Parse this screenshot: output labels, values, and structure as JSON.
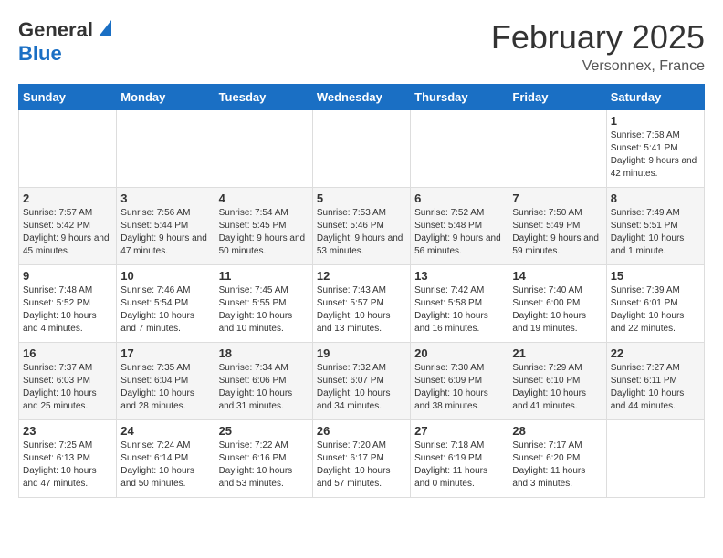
{
  "header": {
    "logo_general": "General",
    "logo_blue": "Blue",
    "month_title": "February 2025",
    "location": "Versonnex, France"
  },
  "calendar": {
    "days_of_week": [
      "Sunday",
      "Monday",
      "Tuesday",
      "Wednesday",
      "Thursday",
      "Friday",
      "Saturday"
    ],
    "weeks": [
      [
        {
          "day": "",
          "info": ""
        },
        {
          "day": "",
          "info": ""
        },
        {
          "day": "",
          "info": ""
        },
        {
          "day": "",
          "info": ""
        },
        {
          "day": "",
          "info": ""
        },
        {
          "day": "",
          "info": ""
        },
        {
          "day": "1",
          "info": "Sunrise: 7:58 AM\nSunset: 5:41 PM\nDaylight: 9 hours and 42 minutes."
        }
      ],
      [
        {
          "day": "2",
          "info": "Sunrise: 7:57 AM\nSunset: 5:42 PM\nDaylight: 9 hours and 45 minutes."
        },
        {
          "day": "3",
          "info": "Sunrise: 7:56 AM\nSunset: 5:44 PM\nDaylight: 9 hours and 47 minutes."
        },
        {
          "day": "4",
          "info": "Sunrise: 7:54 AM\nSunset: 5:45 PM\nDaylight: 9 hours and 50 minutes."
        },
        {
          "day": "5",
          "info": "Sunrise: 7:53 AM\nSunset: 5:46 PM\nDaylight: 9 hours and 53 minutes."
        },
        {
          "day": "6",
          "info": "Sunrise: 7:52 AM\nSunset: 5:48 PM\nDaylight: 9 hours and 56 minutes."
        },
        {
          "day": "7",
          "info": "Sunrise: 7:50 AM\nSunset: 5:49 PM\nDaylight: 9 hours and 59 minutes."
        },
        {
          "day": "8",
          "info": "Sunrise: 7:49 AM\nSunset: 5:51 PM\nDaylight: 10 hours and 1 minute."
        }
      ],
      [
        {
          "day": "9",
          "info": "Sunrise: 7:48 AM\nSunset: 5:52 PM\nDaylight: 10 hours and 4 minutes."
        },
        {
          "day": "10",
          "info": "Sunrise: 7:46 AM\nSunset: 5:54 PM\nDaylight: 10 hours and 7 minutes."
        },
        {
          "day": "11",
          "info": "Sunrise: 7:45 AM\nSunset: 5:55 PM\nDaylight: 10 hours and 10 minutes."
        },
        {
          "day": "12",
          "info": "Sunrise: 7:43 AM\nSunset: 5:57 PM\nDaylight: 10 hours and 13 minutes."
        },
        {
          "day": "13",
          "info": "Sunrise: 7:42 AM\nSunset: 5:58 PM\nDaylight: 10 hours and 16 minutes."
        },
        {
          "day": "14",
          "info": "Sunrise: 7:40 AM\nSunset: 6:00 PM\nDaylight: 10 hours and 19 minutes."
        },
        {
          "day": "15",
          "info": "Sunrise: 7:39 AM\nSunset: 6:01 PM\nDaylight: 10 hours and 22 minutes."
        }
      ],
      [
        {
          "day": "16",
          "info": "Sunrise: 7:37 AM\nSunset: 6:03 PM\nDaylight: 10 hours and 25 minutes."
        },
        {
          "day": "17",
          "info": "Sunrise: 7:35 AM\nSunset: 6:04 PM\nDaylight: 10 hours and 28 minutes."
        },
        {
          "day": "18",
          "info": "Sunrise: 7:34 AM\nSunset: 6:06 PM\nDaylight: 10 hours and 31 minutes."
        },
        {
          "day": "19",
          "info": "Sunrise: 7:32 AM\nSunset: 6:07 PM\nDaylight: 10 hours and 34 minutes."
        },
        {
          "day": "20",
          "info": "Sunrise: 7:30 AM\nSunset: 6:09 PM\nDaylight: 10 hours and 38 minutes."
        },
        {
          "day": "21",
          "info": "Sunrise: 7:29 AM\nSunset: 6:10 PM\nDaylight: 10 hours and 41 minutes."
        },
        {
          "day": "22",
          "info": "Sunrise: 7:27 AM\nSunset: 6:11 PM\nDaylight: 10 hours and 44 minutes."
        }
      ],
      [
        {
          "day": "23",
          "info": "Sunrise: 7:25 AM\nSunset: 6:13 PM\nDaylight: 10 hours and 47 minutes."
        },
        {
          "day": "24",
          "info": "Sunrise: 7:24 AM\nSunset: 6:14 PM\nDaylight: 10 hours and 50 minutes."
        },
        {
          "day": "25",
          "info": "Sunrise: 7:22 AM\nSunset: 6:16 PM\nDaylight: 10 hours and 53 minutes."
        },
        {
          "day": "26",
          "info": "Sunrise: 7:20 AM\nSunset: 6:17 PM\nDaylight: 10 hours and 57 minutes."
        },
        {
          "day": "27",
          "info": "Sunrise: 7:18 AM\nSunset: 6:19 PM\nDaylight: 11 hours and 0 minutes."
        },
        {
          "day": "28",
          "info": "Sunrise: 7:17 AM\nSunset: 6:20 PM\nDaylight: 11 hours and 3 minutes."
        },
        {
          "day": "",
          "info": ""
        }
      ]
    ]
  }
}
